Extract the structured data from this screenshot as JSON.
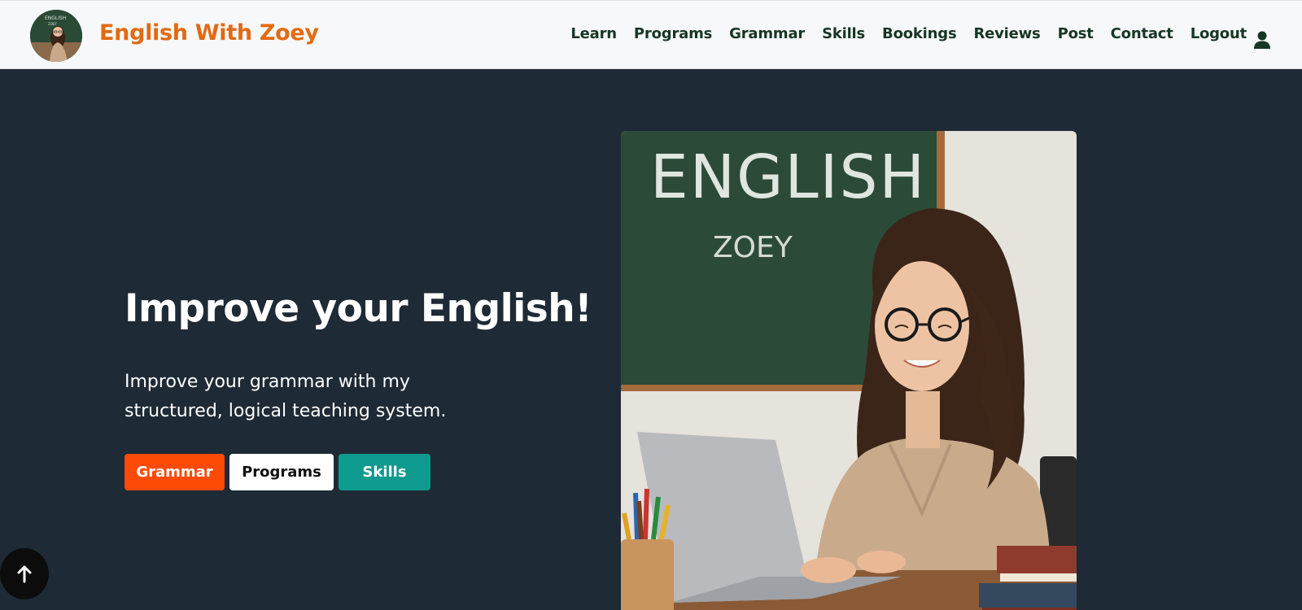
{
  "navbar": {
    "brand": "English With Zoey",
    "links": [
      "Learn",
      "Programs",
      "Grammar",
      "Skills",
      "Bookings",
      "Reviews",
      "Post",
      "Contact",
      "Logout"
    ],
    "user_icon": "user-icon"
  },
  "hero": {
    "title": "Improve your English!",
    "subtitle": "Improve your grammar with my structured, logical teaching system.",
    "buttons": {
      "grammar": "Grammar",
      "programs": "Programs",
      "skills": "Skills"
    },
    "image": {
      "chalkboard_line1": "ENGLISH",
      "chalkboard_line2": "ZOEY"
    }
  },
  "logo_avatar": {
    "board_text": "ENGLISH ZOEY"
  },
  "scroll_top": {
    "icon": "arrow-up-icon"
  },
  "colors": {
    "brand": "#e26a12",
    "nav_text": "#173625",
    "hero_bg": "#1e2a35",
    "grammar_btn": "#fd4a06",
    "skills_btn": "#0e9a8e"
  }
}
